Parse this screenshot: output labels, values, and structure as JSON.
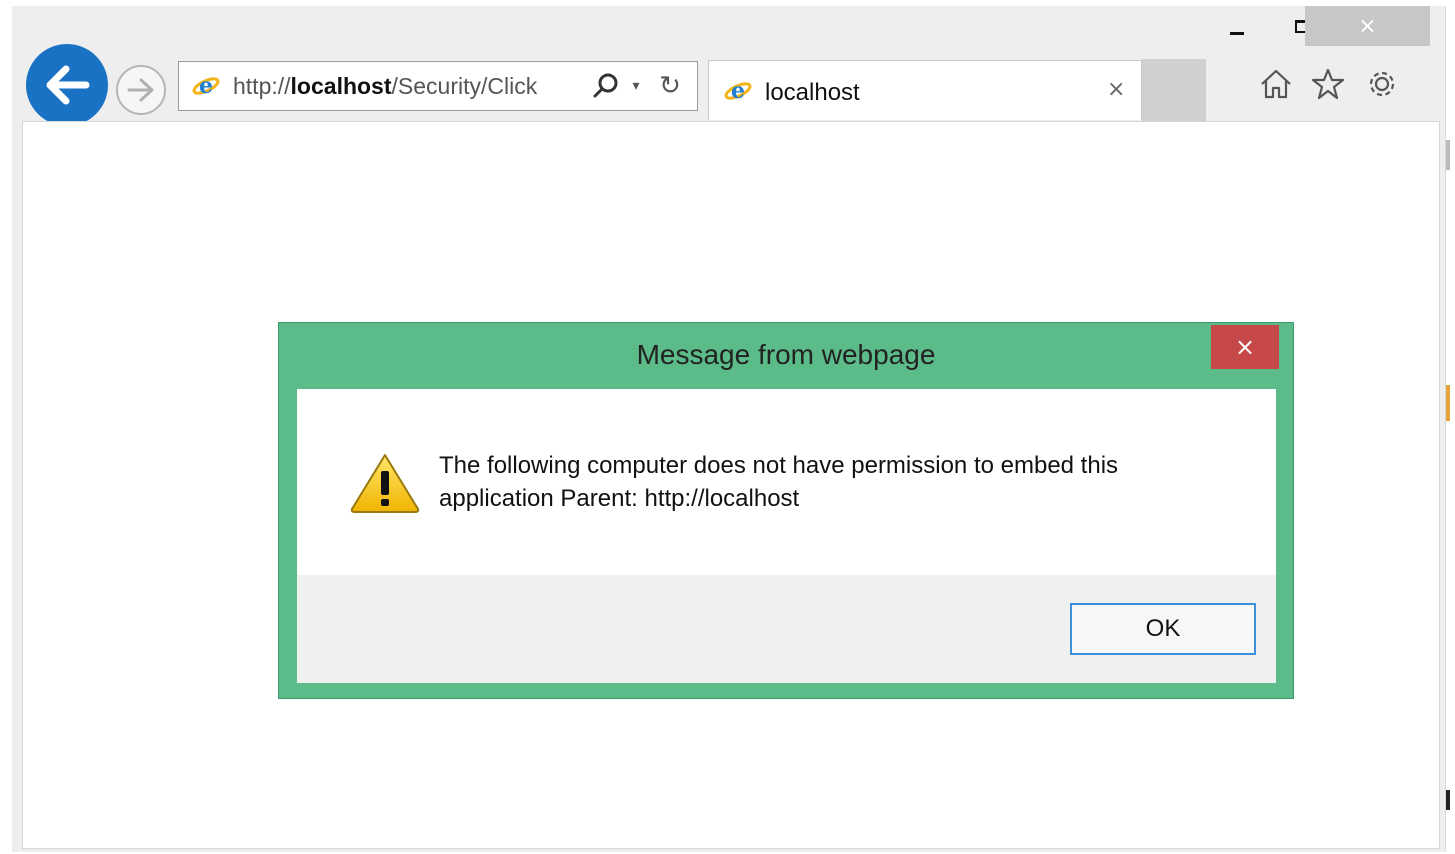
{
  "window": {
    "minimize_label": "minimize",
    "maximize_label": "maximize",
    "close_glyph": "×"
  },
  "navigation": {
    "back_icon": "back-arrow-icon",
    "forward_icon": "forward-arrow-icon"
  },
  "address_bar": {
    "url_prefix": "http://",
    "url_host": "localhost",
    "url_path": "/Security/Click",
    "search_icon": "search-icon",
    "dropdown_glyph": "▾",
    "refresh_glyph": "↻"
  },
  "tab": {
    "title": "localhost",
    "close_glyph": "×"
  },
  "toolbar": {
    "home_icon": "home-icon",
    "favorites_icon": "star-icon",
    "tools_icon": "gear-icon"
  },
  "dialog": {
    "title": "Message from webpage",
    "close_glyph": "×",
    "icon": "warning-icon",
    "message": "The following computer does not have permission to embed this application Parent: http://localhost",
    "ok_label": "OK"
  },
  "colors": {
    "back_button": "#1a72c4",
    "dialog_frame": "#5bbc89",
    "dialog_close": "#c74848",
    "ok_border": "#3b8fdb"
  }
}
